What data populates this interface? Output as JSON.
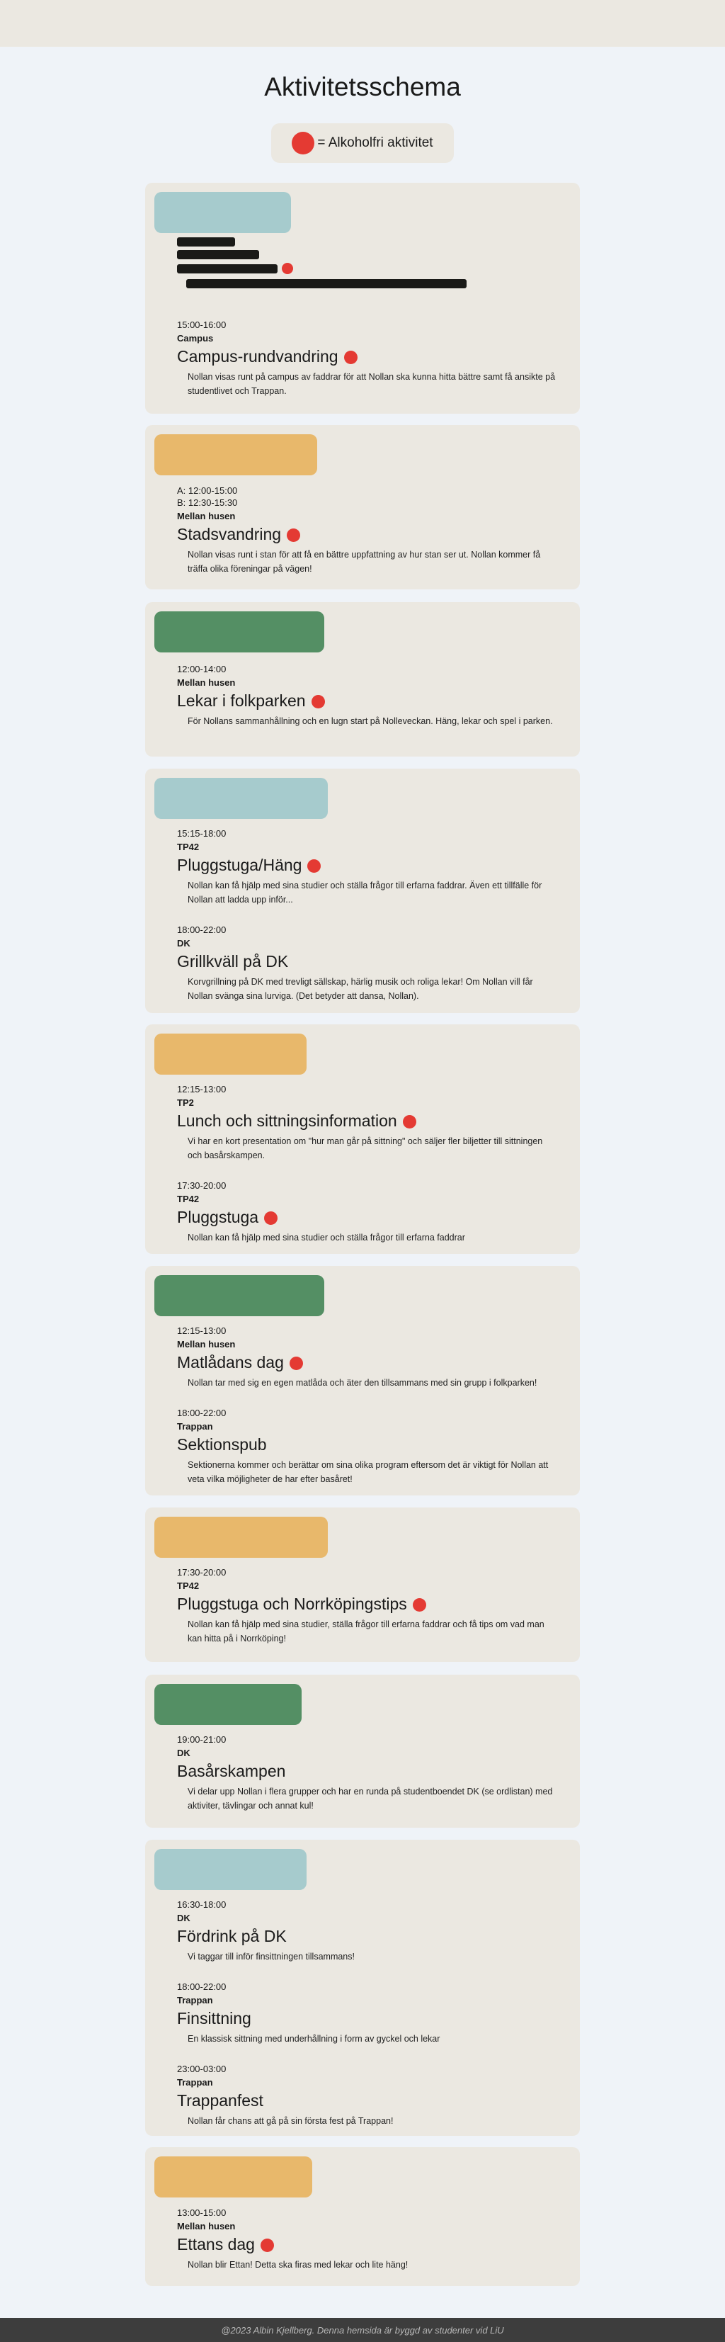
{
  "page_title": "Aktivitetsschema",
  "legend": {
    "text": "= Alkoholfri aktivitet"
  },
  "footer": {
    "text": "@2023 Albin Kjellberg. Denna hemsida är byggd av studenter vid LiU"
  },
  "colors": {
    "red_dot": "#e43a33",
    "blue": "#a6cbcd",
    "yellow": "#e8b86b",
    "green": "#548f64",
    "card": "#ebe8e1"
  },
  "days": [
    {
      "events": [
        {
          "time": "15:00-16:00",
          "place": "Campus",
          "title": "Campus-rundvandring",
          "alcohol_free": true,
          "description": "Nollan visas runt på campus av faddrar för att Nollan ska kunna hitta bättre samt få ansikte på studentlivet och Trappan."
        }
      ]
    },
    {
      "events": [
        {
          "time": "A: 12:00-15:00",
          "time2": "B: 12:30-15:30",
          "place": "Mellan husen",
          "title": "Stadsvandring",
          "alcohol_free": true,
          "description": "Nollan visas runt i stan för att få en bättre uppfattning av hur stan ser ut. Nollan kommer få träffa olika föreningar på vägen!"
        }
      ]
    },
    {
      "events": [
        {
          "time": "12:00-14:00",
          "place": "Mellan husen",
          "title": "Lekar i folkparken",
          "alcohol_free": true,
          "description": "För Nollans sammanhållning och en lugn start på Nolleveckan. Häng, lekar och spel i parken."
        }
      ]
    },
    {
      "events": [
        {
          "time": "15:15-18:00",
          "place": "TP42",
          "title": "Pluggstuga/Häng",
          "alcohol_free": true,
          "description": "Nollan kan få hjälp med sina studier och ställa frågor till erfarna faddrar. Även ett tillfälle för Nollan att ladda upp inför..."
        },
        {
          "time": "18:00-22:00",
          "place": "DK",
          "title": "Grillkväll på DK",
          "alcohol_free": false,
          "description": "Korvgrillning på DK med trevligt sällskap, härlig musik och roliga lekar! Om Nollan vill får Nollan svänga sina lurviga. (Det betyder att dansa, Nollan)."
        }
      ]
    },
    {
      "events": [
        {
          "time": "12:15-13:00",
          "place": "TP2",
          "title": "Lunch och sittningsinformation",
          "alcohol_free": true,
          "description": "Vi har en kort presentation om \"hur man går på sittning\" och säljer fler biljetter till sittningen och basårskampen."
        },
        {
          "time": "17:30-20:00",
          "place": "TP42",
          "title": "Pluggstuga",
          "alcohol_free": true,
          "description": "Nollan kan få hjälp med sina studier och ställa frågor till erfarna faddrar"
        }
      ]
    },
    {
      "events": [
        {
          "time": "12:15-13:00",
          "place": "Mellan husen",
          "title": "Matlådans dag",
          "alcohol_free": true,
          "description": "Nollan tar med sig en egen matlåda och äter den tillsammans med sin grupp i folkparken!"
        },
        {
          "time": "18:00-22:00",
          "place": "Trappan",
          "title": "Sektionspub",
          "alcohol_free": false,
          "description": "Sektionerna kommer och berättar om sina olika program eftersom det är viktigt för Nollan att veta vilka möjligheter de har efter basåret!"
        }
      ]
    },
    {
      "events": [
        {
          "time": "17:30-20:00",
          "place": "TP42",
          "title": "Pluggstuga och Norrköpingstips",
          "alcohol_free": true,
          "description": "Nollan kan få hjälp med sina studier, ställa frågor till erfarna faddrar och få tips om vad man kan hitta på i Norrköping!"
        }
      ]
    },
    {
      "events": [
        {
          "time": "19:00-21:00",
          "place": "DK",
          "title": "Basårskampen",
          "alcohol_free": false,
          "description": "Vi delar upp Nollan i flera grupper och har en runda på studentboendet DK (se ordlistan) med aktiviter, tävlingar och annat kul!"
        }
      ]
    },
    {
      "events": [
        {
          "time": "16:30-18:00",
          "place": "DK",
          "title": "Fördrink på DK",
          "alcohol_free": false,
          "description": "Vi taggar till inför finsittningen tillsammans!"
        },
        {
          "time": "18:00-22:00",
          "place": "Trappan",
          "title": "Finsittning",
          "alcohol_free": false,
          "description": "En klassisk sittning med underhållning i form av gyckel och lekar"
        },
        {
          "time": "23:00-03:00",
          "place": "Trappan",
          "title": "Trappanfest",
          "alcohol_free": false,
          "description": "Nollan får chans att gå på sin första fest på Trappan!"
        }
      ]
    },
    {
      "events": [
        {
          "time": "13:00-15:00",
          "place": "Mellan husen",
          "title": "Ettans dag",
          "alcohol_free": true,
          "description": "Nollan blir Ettan! Detta ska firas med lekar och lite häng!"
        }
      ]
    }
  ]
}
